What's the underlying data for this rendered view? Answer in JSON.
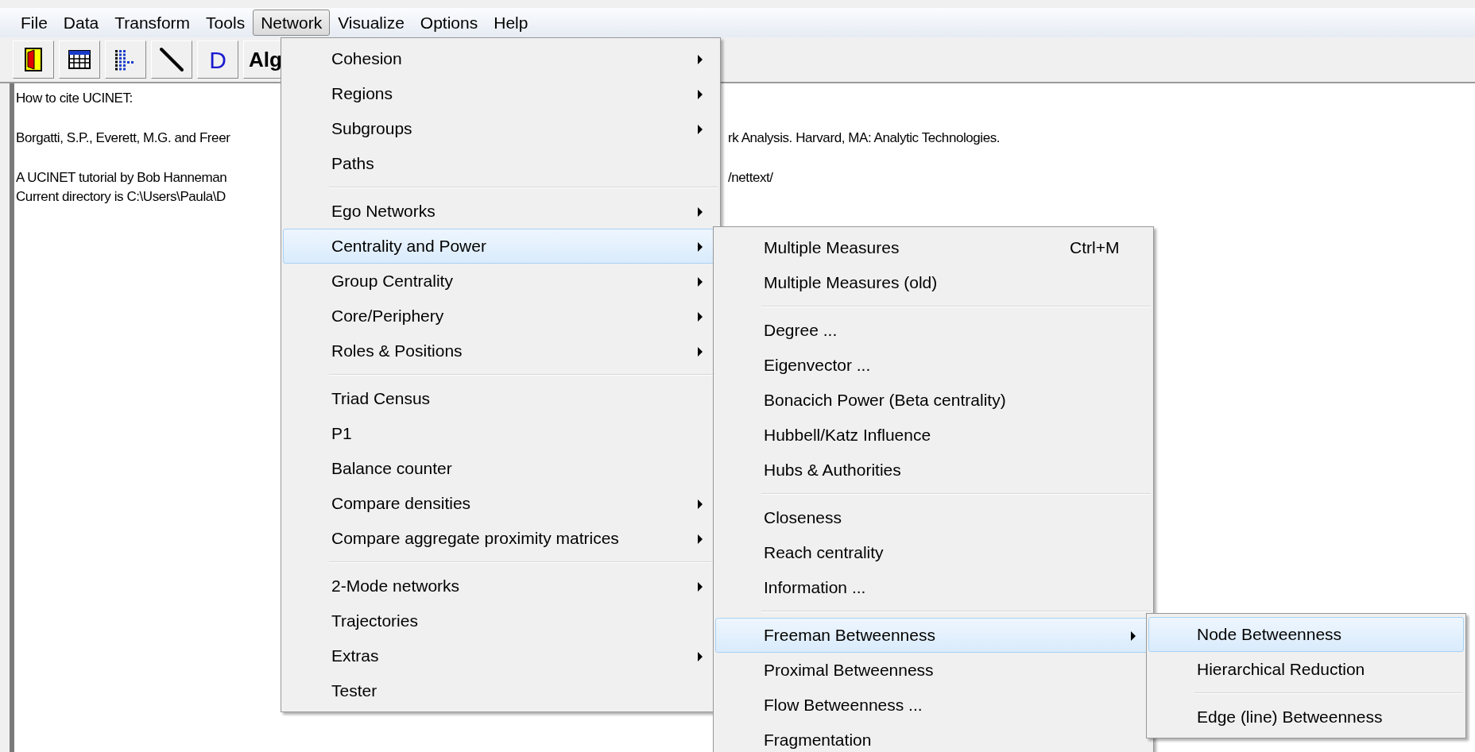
{
  "menu_bar": [
    {
      "label": "File",
      "selected": false
    },
    {
      "label": "Data",
      "selected": false
    },
    {
      "label": "Transform",
      "selected": false
    },
    {
      "label": "Tools",
      "selected": false
    },
    {
      "label": "Network",
      "selected": true
    },
    {
      "label": "Visualize",
      "selected": false
    },
    {
      "label": "Options",
      "selected": false
    },
    {
      "label": "Help",
      "selected": false
    }
  ],
  "toolbar_labels": [
    "D",
    "Alg"
  ],
  "output_paragraphs": [
    [
      {
        "left": "How to cite UCINET:"
      }
    ],
    [
      {
        "left": "Borgatti, S.P., Everett, M.G. and Freer",
        "right": "rk Analysis. Harvard, MA: Analytic Technologies."
      }
    ],
    [
      {
        "left": "A UCINET tutorial by Bob Hanneman",
        "right": "/nettext/"
      },
      {
        "left": "Current directory is C:\\Users\\Paula\\D"
      }
    ]
  ],
  "menus": [
    {
      "items": [
        {
          "kind": "item",
          "label": "Cohesion",
          "submenu": true,
          "selected": false
        },
        {
          "kind": "item",
          "label": "Regions",
          "submenu": true,
          "selected": false
        },
        {
          "kind": "item",
          "label": "Subgroups",
          "submenu": true,
          "selected": false
        },
        {
          "kind": "item",
          "label": "Paths",
          "submenu": false,
          "selected": false
        },
        {
          "kind": "separator"
        },
        {
          "kind": "item",
          "label": "Ego Networks",
          "submenu": true,
          "selected": false
        },
        {
          "kind": "item",
          "label": "Centrality and Power",
          "submenu": true,
          "selected": true
        },
        {
          "kind": "item",
          "label": "Group Centrality",
          "submenu": true,
          "selected": false
        },
        {
          "kind": "item",
          "label": "Core/Periphery",
          "submenu": true,
          "selected": false
        },
        {
          "kind": "item",
          "label": "Roles & Positions",
          "submenu": true,
          "selected": false
        },
        {
          "kind": "separator"
        },
        {
          "kind": "item",
          "label": "Triad Census",
          "submenu": false,
          "selected": false
        },
        {
          "kind": "item",
          "label": "P1",
          "submenu": false,
          "selected": false
        },
        {
          "kind": "item",
          "label": "Balance counter",
          "submenu": false,
          "selected": false
        },
        {
          "kind": "item",
          "label": "Compare densities",
          "submenu": true,
          "selected": false
        },
        {
          "kind": "item",
          "label": "Compare aggregate proximity matrices",
          "submenu": true,
          "selected": false
        },
        {
          "kind": "separator"
        },
        {
          "kind": "item",
          "label": "2-Mode networks",
          "submenu": true,
          "selected": false
        },
        {
          "kind": "item",
          "label": "Trajectories",
          "submenu": false,
          "selected": false
        },
        {
          "kind": "item",
          "label": "Extras",
          "submenu": true,
          "selected": false
        },
        {
          "kind": "item",
          "label": "Tester",
          "submenu": false,
          "selected": false
        }
      ]
    },
    {
      "items": [
        {
          "kind": "item",
          "label": "Multiple Measures",
          "shortcut": "Ctrl+M",
          "submenu": false,
          "selected": false
        },
        {
          "kind": "item",
          "label": "Multiple Measures (old)",
          "submenu": false,
          "selected": false
        },
        {
          "kind": "separator"
        },
        {
          "kind": "item",
          "label": "Degree ...",
          "submenu": false,
          "selected": false
        },
        {
          "kind": "item",
          "label": "Eigenvector ...",
          "submenu": false,
          "selected": false
        },
        {
          "kind": "item",
          "label": "Bonacich Power (Beta centrality)",
          "submenu": false,
          "selected": false
        },
        {
          "kind": "item",
          "label": "Hubbell/Katz Influence",
          "submenu": false,
          "selected": false
        },
        {
          "kind": "item",
          "label": "Hubs & Authorities",
          "submenu": false,
          "selected": false
        },
        {
          "kind": "separator"
        },
        {
          "kind": "item",
          "label": "Closeness",
          "submenu": false,
          "selected": false
        },
        {
          "kind": "item",
          "label": "Reach centrality",
          "submenu": false,
          "selected": false
        },
        {
          "kind": "item",
          "label": "Information ...",
          "submenu": false,
          "selected": false
        },
        {
          "kind": "separator"
        },
        {
          "kind": "item",
          "label": "Freeman Betweenness",
          "submenu": true,
          "selected": true
        },
        {
          "kind": "item",
          "label": "Proximal Betweenness",
          "submenu": false,
          "selected": false
        },
        {
          "kind": "item",
          "label": "Flow Betweenness ...",
          "submenu": false,
          "selected": false
        },
        {
          "kind": "item",
          "label": "Fragmentation",
          "submenu": false,
          "selected": false
        }
      ]
    },
    {
      "items": [
        {
          "kind": "item",
          "label": "Node Betweenness",
          "submenu": false,
          "selected": true
        },
        {
          "kind": "item",
          "label": "Hierarchical Reduction",
          "submenu": false,
          "selected": false
        },
        {
          "kind": "separator"
        },
        {
          "kind": "item",
          "label": "Edge (line) Betweenness",
          "submenu": false,
          "selected": false
        }
      ]
    }
  ]
}
